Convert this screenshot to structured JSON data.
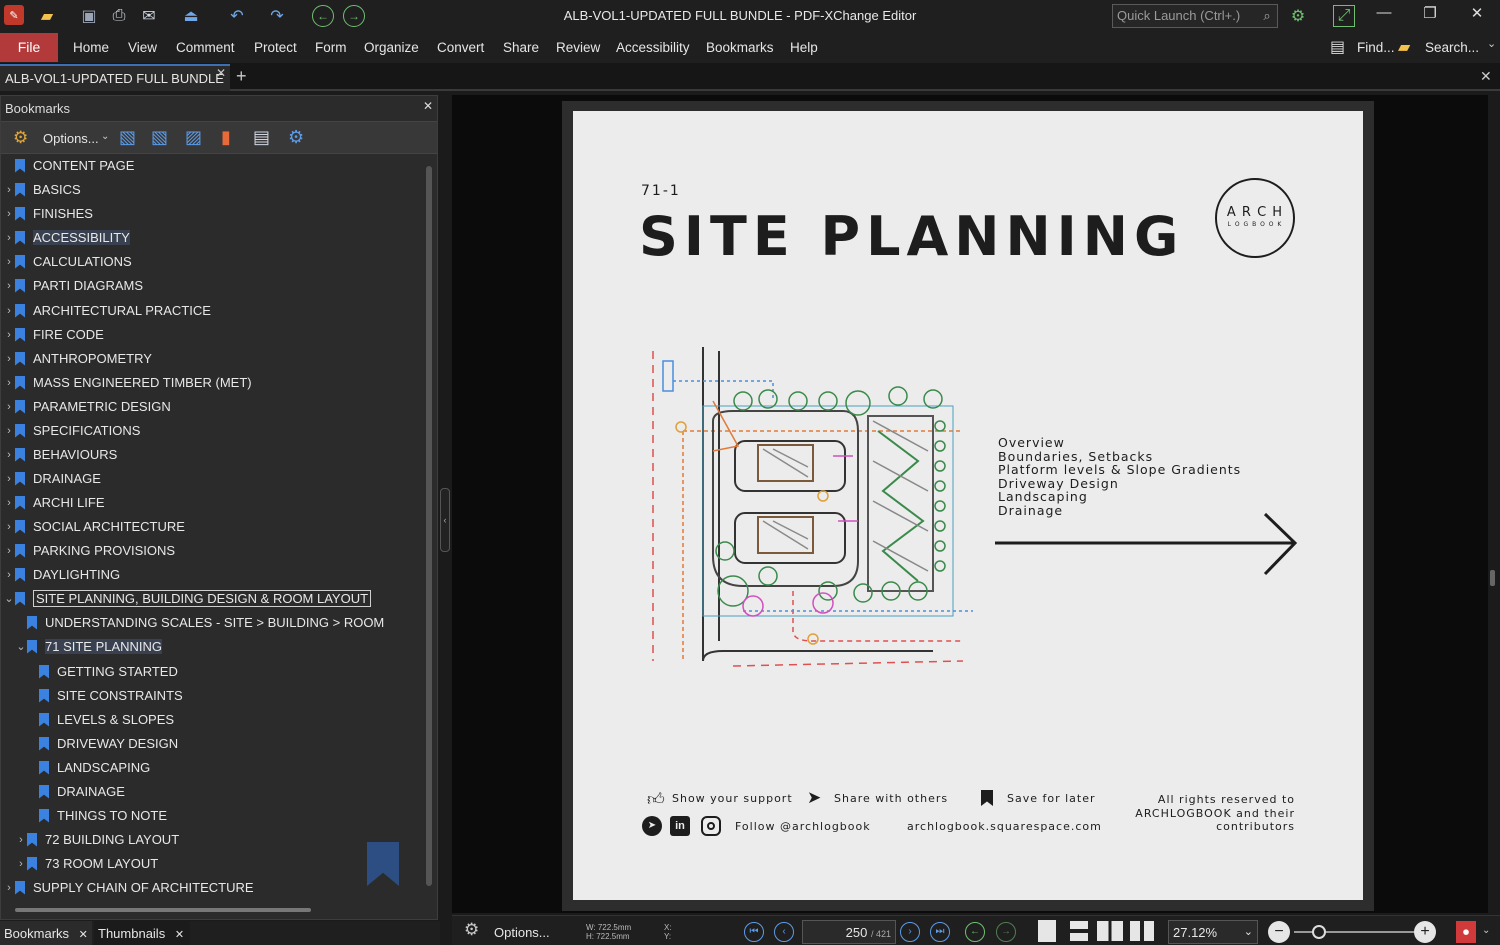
{
  "window": {
    "title": "ALB-VOL1-UPDATED FULL BUNDLE - PDF-XChange Editor",
    "quick_launch_placeholder": "Quick Launch (Ctrl+.)"
  },
  "menu": {
    "file": "File",
    "items": [
      "Home",
      "View",
      "Comment",
      "Protect",
      "Form",
      "Organize",
      "Convert",
      "Share",
      "Review",
      "Accessibility",
      "Bookmarks",
      "Help"
    ],
    "find": "Find...",
    "search": "Search..."
  },
  "tab": {
    "name": "ALB-VOL1-UPDATED FULL BUNDLE"
  },
  "bookmarks_panel": {
    "title": "Bookmarks",
    "options": "Options...",
    "items": [
      {
        "label": "CONTENT PAGE"
      },
      {
        "label": "BASICS"
      },
      {
        "label": "FINISHES"
      },
      {
        "label": "ACCESSIBILITY"
      },
      {
        "label": "CALCULATIONS"
      },
      {
        "label": "PARTI DIAGRAMS"
      },
      {
        "label": "ARCHITECTURAL PRACTICE"
      },
      {
        "label": "FIRE CODE"
      },
      {
        "label": "ANTHROPOMETRY"
      },
      {
        "label": "MASS ENGINEERED TIMBER (MET)"
      },
      {
        "label": "PARAMETRIC DESIGN"
      },
      {
        "label": "SPECIFICATIONS"
      },
      {
        "label": "BEHAVIOURS"
      },
      {
        "label": "DRAINAGE"
      },
      {
        "label": "ARCHI LIFE"
      },
      {
        "label": "SOCIAL ARCHITECTURE"
      },
      {
        "label": "PARKING PROVISIONS"
      },
      {
        "label": "DAYLIGHTING"
      },
      {
        "label": "SITE PLANNING, BUILDING DESIGN & ROOM LAYOUT"
      },
      {
        "label": "UNDERSTANDING SCALES - SITE > BUILDING > ROOM"
      },
      {
        "label": "71 SITE PLANNING"
      },
      {
        "label": "GETTING STARTED"
      },
      {
        "label": "SITE CONSTRAINTS"
      },
      {
        "label": "LEVELS & SLOPES"
      },
      {
        "label": "DRIVEWAY DESIGN"
      },
      {
        "label": "LANDSCAPING"
      },
      {
        "label": "DRAINAGE"
      },
      {
        "label": "THINGS TO NOTE"
      },
      {
        "label": "72 BUILDING LAYOUT"
      },
      {
        "label": "73 ROOM LAYOUT"
      },
      {
        "label": "SUPPLY CHAIN OF ARCHITECTURE"
      }
    ]
  },
  "bottom_tabs": [
    "Bookmarks",
    "Thumbnails"
  ],
  "page": {
    "number": "71-1",
    "title": "SITE PLANNING",
    "logo_top": "A R C H",
    "logo_bottom": "L O G B O O K",
    "overview": [
      "Overview",
      "Boundaries, Setbacks",
      "Platform levels & Slope Gradients",
      "Driveway Design",
      "Landscaping",
      "Drainage"
    ],
    "footer": {
      "support": "Show your support",
      "share": "Share with others",
      "save": "Save for later",
      "follow": "Follow @archlogbook",
      "website": "archlogbook.squarespace.com",
      "rights": [
        "All rights reserved to",
        "ARCHLOGBOOK and their",
        "contributors"
      ]
    }
  },
  "statusbar": {
    "options": "Options...",
    "w": "W: 722.5mm",
    "h": "H: 722.5mm",
    "x": "X:",
    "y": "Y:",
    "current_page": "250",
    "total_pages": "/ 421",
    "zoom": "27.12%"
  },
  "colors": {
    "accent_red": "#b33a3a",
    "bookmark_blue": "#3b82e0"
  }
}
